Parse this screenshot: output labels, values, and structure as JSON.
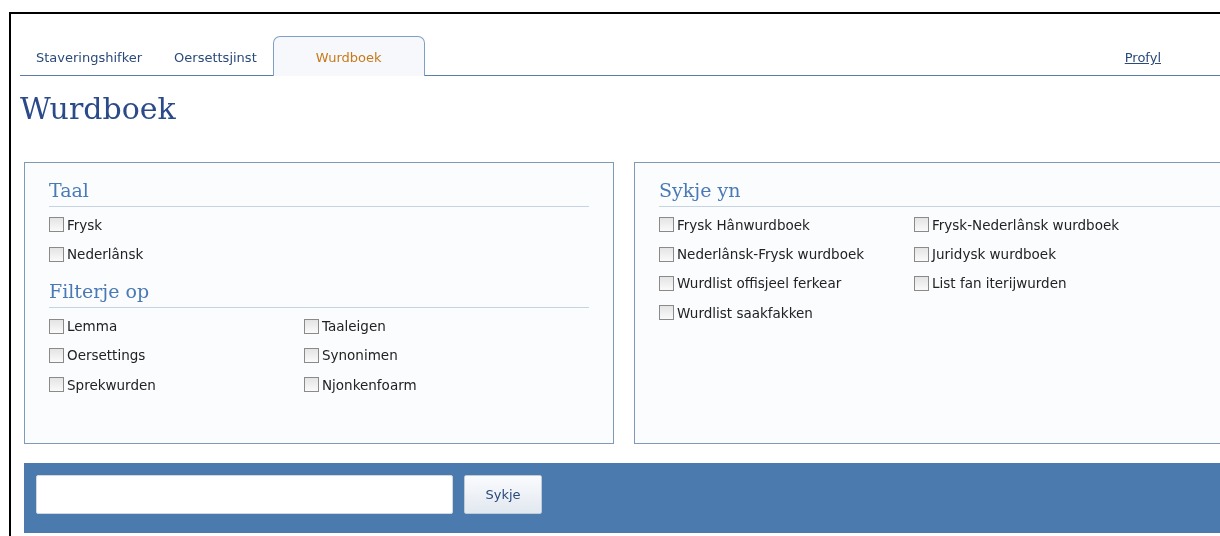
{
  "tabs": [
    {
      "label": "Staveringshifker",
      "selected": false
    },
    {
      "label": "Oersettsjinst",
      "selected": false
    },
    {
      "label": "Wurdboek",
      "selected": true
    }
  ],
  "profile_link": "Profyl",
  "page_title": "Wurdboek",
  "panels": [
    {
      "groups": [
        {
          "heading": "Taal",
          "kind": "single-column",
          "options": [
            {
              "label": "Frysk",
              "checked": false
            },
            {
              "label": "Nederlânsk",
              "checked": false
            }
          ]
        },
        {
          "heading": "Filterje op",
          "kind": "two-column",
          "options": [
            {
              "label": "Lemma",
              "checked": false
            },
            {
              "label": "Taaleigen",
              "checked": false
            },
            {
              "label": "Oersettings",
              "checked": false
            },
            {
              "label": "Synonimen",
              "checked": false
            },
            {
              "label": "Sprekwurden",
              "checked": false
            },
            {
              "label": "Njonkenfoarm",
              "checked": false
            }
          ]
        }
      ]
    },
    {
      "groups": [
        {
          "heading": "Sykje yn",
          "kind": "two-column",
          "options": [
            {
              "label": "Frysk Hânwurdboek",
              "checked": false
            },
            {
              "label": "Frysk-Nederlânsk wurdboek",
              "checked": false
            },
            {
              "label": "Nederlânsk-Frysk wurdboek",
              "checked": false
            },
            {
              "label": "Juridysk wurdboek",
              "checked": false
            },
            {
              "label": "Wurdlist offisjeel ferkear",
              "checked": false
            },
            {
              "label": "List fan iterijwurden",
              "checked": false
            },
            {
              "label": "Wurdlist saakfakken",
              "checked": false
            }
          ]
        }
      ]
    }
  ],
  "search": {
    "button": "Sykje"
  }
}
